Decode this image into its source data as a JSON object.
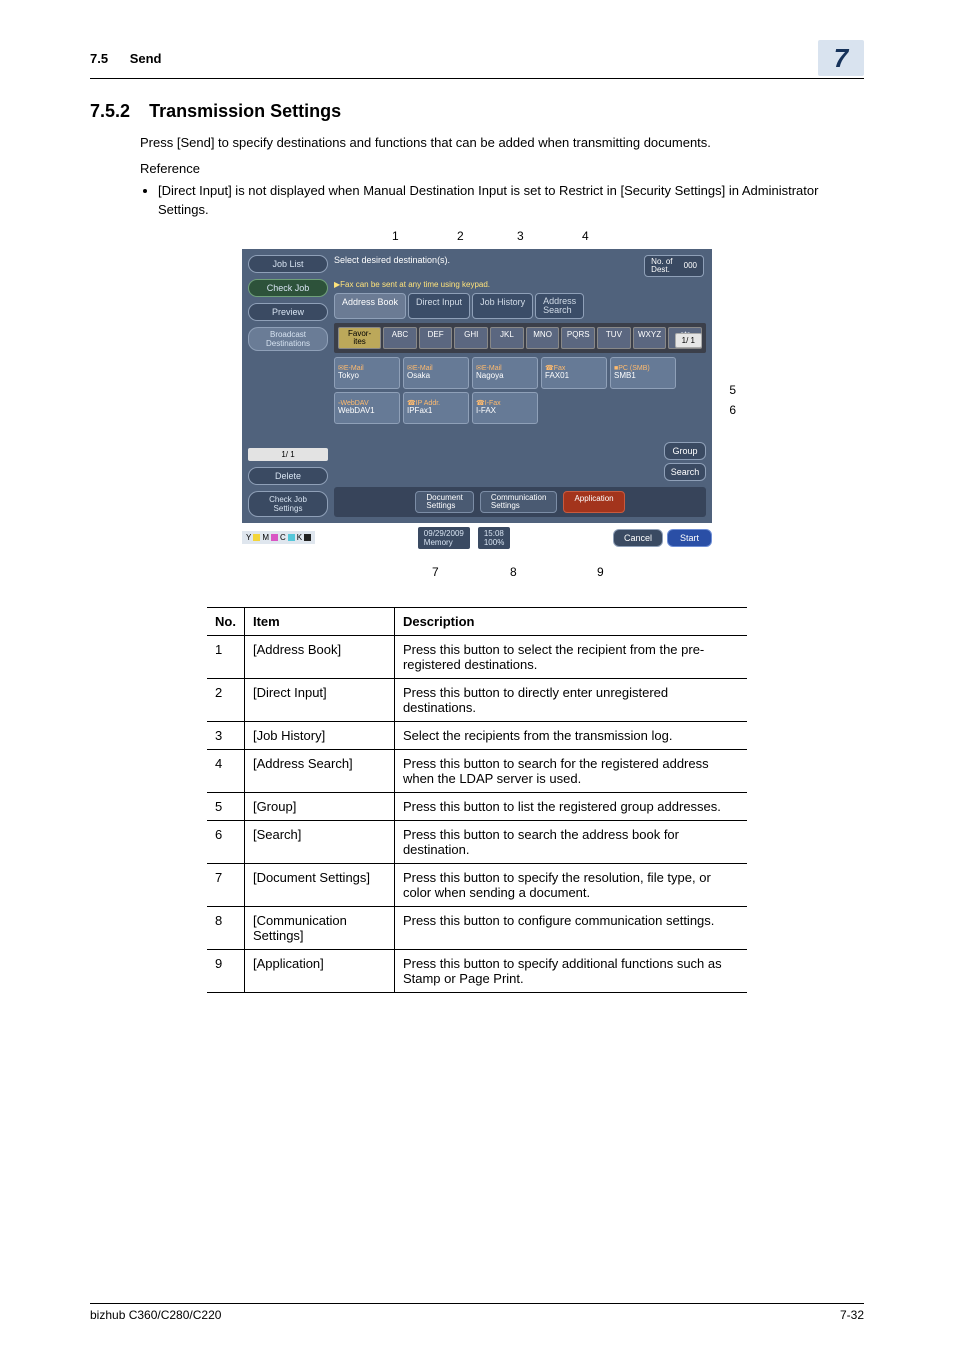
{
  "header": {
    "section_num": "7.5",
    "section_name": "Send",
    "chapter": "7"
  },
  "heading": {
    "num": "7.5.2",
    "title": "Transmission Settings"
  },
  "intro": "Press [Send] to specify destinations and functions that can be added when transmitting documents.",
  "reference_label": "Reference",
  "bullet": "[Direct Input] is not displayed when Manual Destination Input is set to Restrict in [Security Settings] in Administrator Settings.",
  "shot": {
    "side": {
      "job_list": "Job List",
      "check_job": "Check Job",
      "preview": "Preview",
      "broadcast": "Broadcast\nDestinations",
      "page_side": "1/  1",
      "delete": "Delete",
      "check_set": "Check Job\nSettings"
    },
    "topline": "Select desired destination(s).",
    "hint": "▶Fax can be sent at any time using keypad.",
    "dest_label": "No. of\nDest.",
    "dest_count": "000",
    "tabs": {
      "addr": "Address Book",
      "direct": "Direct Input",
      "hist": "Job History",
      "search": "Address\nSearch"
    },
    "alpha": [
      "Favor-\nites",
      "ABC",
      "DEF",
      "GHI",
      "JKL",
      "MNO",
      "PQRS",
      "TUV",
      "WXYZ",
      "etc"
    ],
    "cards": [
      {
        "t": "✉E-Mail",
        "s": "Tokyo"
      },
      {
        "t": "✉E-Mail",
        "s": "Osaka"
      },
      {
        "t": "✉E-Mail",
        "s": "Nagoya"
      },
      {
        "t": "☎Fax",
        "s": "FAX01"
      },
      {
        "t": "■PC (SMB)",
        "s": "SMB1"
      },
      {
        "t": "◦WebDAV",
        "s": "WebDAV1"
      },
      {
        "t": "☎IP Addr.",
        "s": "IPFax1"
      },
      {
        "t": "☎I-Fax",
        "s": "I-FAX"
      }
    ],
    "page_main": "1/  1",
    "rbtns": {
      "group": "Group",
      "search": "Search"
    },
    "bottom": {
      "doc": "Document\nSettings",
      "comm": "Communication\nSettings",
      "app": "Application"
    },
    "status": {
      "date": "09/29/2009",
      "mem": "Memory",
      "time": "15:08",
      "pct": "100%"
    },
    "actions": {
      "cancel": "Cancel",
      "start": "Start"
    }
  },
  "callouts": {
    "c1": "1",
    "c2": "2",
    "c3": "3",
    "c4": "4",
    "c5": "5",
    "c6": "6",
    "c7": "7",
    "c8": "8",
    "c9": "9"
  },
  "table": {
    "headers": {
      "no": "No.",
      "item": "Item",
      "desc": "Description"
    },
    "rows": [
      {
        "no": "1",
        "item": "[Address Book]",
        "desc": "Press this button to select the recipient from the pre-registered destinations."
      },
      {
        "no": "2",
        "item": "[Direct Input]",
        "desc": "Press this button to directly enter unregistered destinations."
      },
      {
        "no": "3",
        "item": "[Job History]",
        "desc": "Select the recipients from the transmission log."
      },
      {
        "no": "4",
        "item": "[Address Search]",
        "desc": "Press this button to search for the registered address when the LDAP server is used."
      },
      {
        "no": "5",
        "item": "[Group]",
        "desc": "Press this button to list the registered group addresses."
      },
      {
        "no": "6",
        "item": "[Search]",
        "desc": "Press this button to search the address book for destination."
      },
      {
        "no": "7",
        "item": "[Document Settings]",
        "desc": "Press this button to specify the resolution, file type, or color when sending a document."
      },
      {
        "no": "8",
        "item": "[Communication Settings]",
        "desc": "Press this button to configure communication settings."
      },
      {
        "no": "9",
        "item": "[Application]",
        "desc": "Press this button to specify additional functions such as Stamp or Page Print."
      }
    ]
  },
  "footer": {
    "model": "bizhub C360/C280/C220",
    "page": "7-32"
  }
}
